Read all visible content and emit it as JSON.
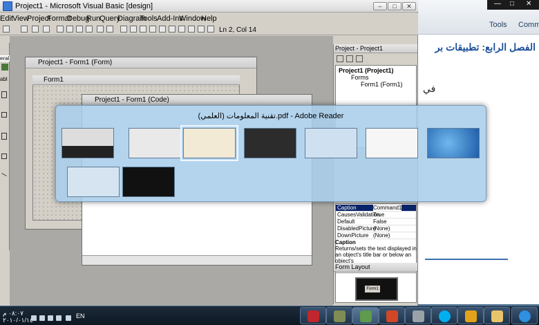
{
  "vb": {
    "title": "Project1 - Microsoft Visual Basic [design]",
    "menu": [
      "Edit",
      "View",
      "Project",
      "Format",
      "Debug",
      "Run",
      "Query",
      "Diagram",
      "Tools",
      "Add-Ins",
      "Window",
      "Help"
    ],
    "cursor_position": "Ln 2, Col 14",
    "form_window_title": "Project1 - Form1 (Form)",
    "form_title": "Form1",
    "code_window_title": "Project1 - Form1 (Code)",
    "toolbox_label": "eral",
    "toolbox_label2": "abl"
  },
  "project_panel": {
    "title": "Project - Project1",
    "root": "Project1 (Project1)",
    "folder": "Forms",
    "form_item": "Form1 (Form1)",
    "properties": [
      {
        "key": "Caption",
        "value": "Command1"
      },
      {
        "key": "CausesValidation",
        "value": "True"
      },
      {
        "key": "Default",
        "value": "False"
      },
      {
        "key": "DisabledPicture",
        "value": "(None)"
      },
      {
        "key": "DownPicture",
        "value": "(None)"
      }
    ],
    "desc_title": "Caption",
    "desc_text": "Returns/sets the text displayed in an object's title bar or below an object's",
    "form_layout_title": "Form Layout",
    "form_layout_form": "Form1"
  },
  "pdf_reader": {
    "tools_label": "Tools",
    "comment_label": "Comm",
    "heading": "الفصل الرابع: تطبيقات بر",
    "fee": "في"
  },
  "switcher": {
    "title": "تقنية المعلومات (العلمي).pdf - Adobe Reader"
  },
  "taskbar": {
    "time": "٠٨:٠٧ م",
    "date": "٢٠١٠/٠١/١٤",
    "lang": "EN"
  }
}
